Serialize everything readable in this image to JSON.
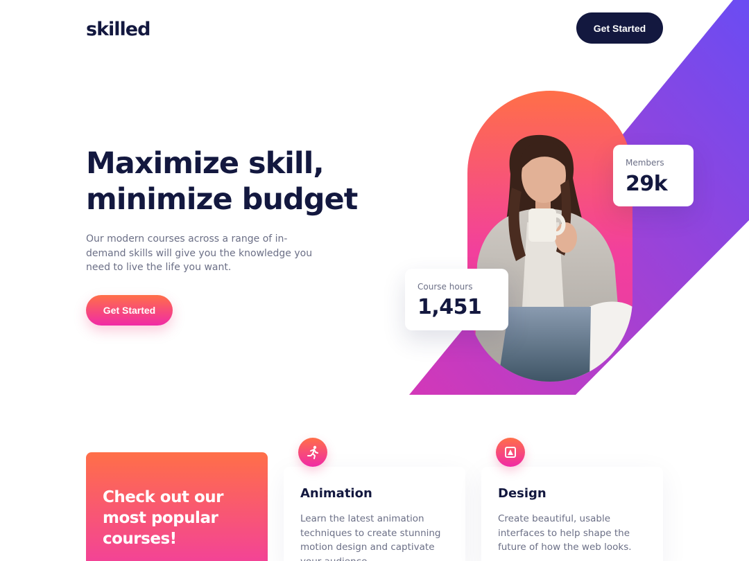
{
  "brand": {
    "logo": "skilled"
  },
  "nav": {
    "cta_label": "Get Started"
  },
  "hero": {
    "title_line1": "Maximize skill,",
    "title_line2": "minimize budget",
    "description": "Our modern courses across a range of in-demand skills will give you the knowledge you need to live the life you want.",
    "cta_label": "Get Started"
  },
  "stats": {
    "members": {
      "label": "Members",
      "value": "29k"
    },
    "course_hours": {
      "label": "Course hours",
      "value": "1,451"
    }
  },
  "promo": {
    "title": "Check out our most popular courses!"
  },
  "courses": [
    {
      "icon": "running-person-icon",
      "title": "Animation",
      "description": "Learn the latest animation techniques to create stunning motion design and captivate your audience."
    },
    {
      "icon": "design-icon",
      "title": "Design",
      "description": "Create beautiful, usable interfaces to help shape the future of how the web looks."
    }
  ],
  "colors": {
    "navy": "#13183f",
    "gradient_orange": "#ff6f48",
    "gradient_pink": "#f02aa6",
    "diagonal_purple_top": "#6a4cf3",
    "diagonal_magenta_bottom": "#d338b8",
    "muted_text": "#6b6f86"
  }
}
